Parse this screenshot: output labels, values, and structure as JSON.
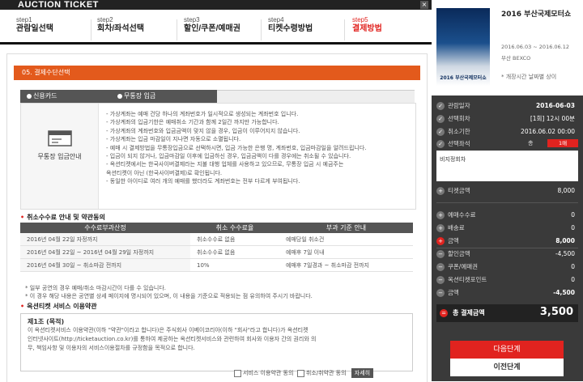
{
  "header": {
    "title": "AUCTION TICKET",
    "close_label": "×"
  },
  "steps": [
    {
      "num": "step1",
      "label": "관람일선택"
    },
    {
      "num": "step2",
      "label": "회차/좌석선택"
    },
    {
      "num": "step3",
      "label": "할인/쿠폰/예매권"
    },
    {
      "num": "step4",
      "label": "티켓수령방법"
    },
    {
      "num": "step5",
      "label": "결제방법"
    }
  ],
  "section_title": "05. 결제수단선택",
  "pay_methods": {
    "card": "신용카드",
    "bank": "무통장 입금"
  },
  "pay_icon_label": "무통장 입금안내",
  "pay_notes": [
    "- 가상계좌는 예매 건당 하나의 계좌번호가 일시적으로 생성되는 계좌번호 입니다.",
    "- 가상계좌의 입금기한은 예매취소 기간과 함께 2일간 까지만 가능합니다.",
    "- 가상계좌의 계좌번호와 입금금액이 맞지 않을 경우, 입금이 이루어지지 않습니다.",
    "- 가상계좌는 입금 마감일이 지나면 자동으로 소멸됩니다.",
    "- 예매 시 결제방법을 무통장입금으로 선택하시면, 입금 가능한 은행 명, 계좌번호, 입금마감일을 알려드립니다.",
    "- 입금이 되지 않거나, 입금마감일 이후에 입금하신 경우, 입금금액이 다를 경우에는 취소될 수 있습니다.",
    "- 옥션티켓에서는 한국사이버결제라는 지불 대행 업체를 사용하고 있으므로, 무통장 입금 시 예금주는",
    "  옥션티켓이 아닌 (한국사이버결제)로 확인됩니다.",
    "- 동일한 아이디로 여러 개의 예매를 했더라도 계좌번호는 전부 다르게 부여됩니다."
  ],
  "fee_section_title": "취소수수료 안내 및 약관동의",
  "fee_table": {
    "headers": [
      "수수료부과산정",
      "취소 수수료율",
      "부과 기준 안내"
    ],
    "rows": [
      [
        "2016년 04월 22일 자정까지",
        "취소수수료 없음",
        "예매당일 취소건"
      ],
      [
        "2016년 04월 22일 ~ 2016년 04월 29일 자정까지",
        "취소수수료 없음",
        "예매후 7일 이내"
      ],
      [
        "2016년 04월 30일 ~ 취소마감 전까지",
        "10%",
        "예매후 7일경과 ~ 취소마감 전까지"
      ]
    ]
  },
  "fee_notes": [
    "* 일부 공연의 경우 예매/취소 마감시간이 다를 수 있습니다.",
    "* 이 경우 해당 내용은 공연별 상세 페이지에 명시되어 있으며, 이 내용을 기준으로 적용되는 점 유의하여 주시기 바랍니다."
  ],
  "terms_section_title": "옥션티켓 서비스 이용약관",
  "terms_lines": [
    "제1조 (목적)",
    "이 옥션티켓서비스 이용약관(이하 \"약관\"이라고 합니다)은 주식회사 이베이코리아(이하 \"회사\"라고 합니다)가 옥션티켓",
    "인터넷사이트(http://ticketauction.co.kr)를 통하여 제공하는 옥션티켓서비스와 관련하여 회사와 이용자 간의 권리와 의",
    "무, 책임사항 및 이용자의 서비스이용절차를 규정함을 목적으로 합니다."
  ],
  "agree": {
    "service_terms": "서비스 이용약관 동의",
    "cancel_terms": "취소/취약관 동의",
    "detail_button": "자세히"
  },
  "event": {
    "title": "2016 부산국제모터쇼",
    "poster_text": "2016 부산국제모터쇼",
    "date_range": "2016.06.03 ~ 2016.06.12",
    "venue": "부산 BEXCO",
    "note": "* 개장시간 날짜별 상이"
  },
  "summary": {
    "rows": [
      {
        "key": "관람일자",
        "value": "2016-06-03",
        "icon": "check"
      },
      {
        "key": "선택회차",
        "value": "[1회] 12시 00분",
        "icon": "check"
      },
      {
        "key": "취소기한",
        "value": "2016.06.02 00:00",
        "icon": "check"
      },
      {
        "key": "선택좌석",
        "value": "",
        "icon": "check"
      }
    ],
    "seat_count_label": "총",
    "seat_count_badge": "1매",
    "seat_text": "비지정회차",
    "amounts": [
      {
        "key": "티켓금액",
        "value": "8,000",
        "icon": "+"
      },
      {
        "key": "예매수수료",
        "value": "0",
        "icon": "+"
      },
      {
        "key": "배송료",
        "value": "0",
        "icon": "+"
      },
      {
        "key": "금액",
        "value": "8,000",
        "icon": "+",
        "strong": true
      },
      {
        "key": "할인금액",
        "value": "-4,500",
        "icon": "−"
      },
      {
        "key": "쿠폰/예매권",
        "value": "0",
        "icon": "−"
      },
      {
        "key": "옥션티켓포인트",
        "value": "0",
        "icon": "−"
      },
      {
        "key": "금액",
        "value": "-4,500",
        "icon": "−",
        "strong": true
      }
    ],
    "total_label": "총 결제금액",
    "total_value": "3,500"
  },
  "buttons": {
    "next": "다음단계",
    "prev": "이전단계"
  },
  "colors": {
    "accent": "#e1231f",
    "section_orange": "#e35a1c",
    "panel_dark": "#3a3a3a"
  }
}
